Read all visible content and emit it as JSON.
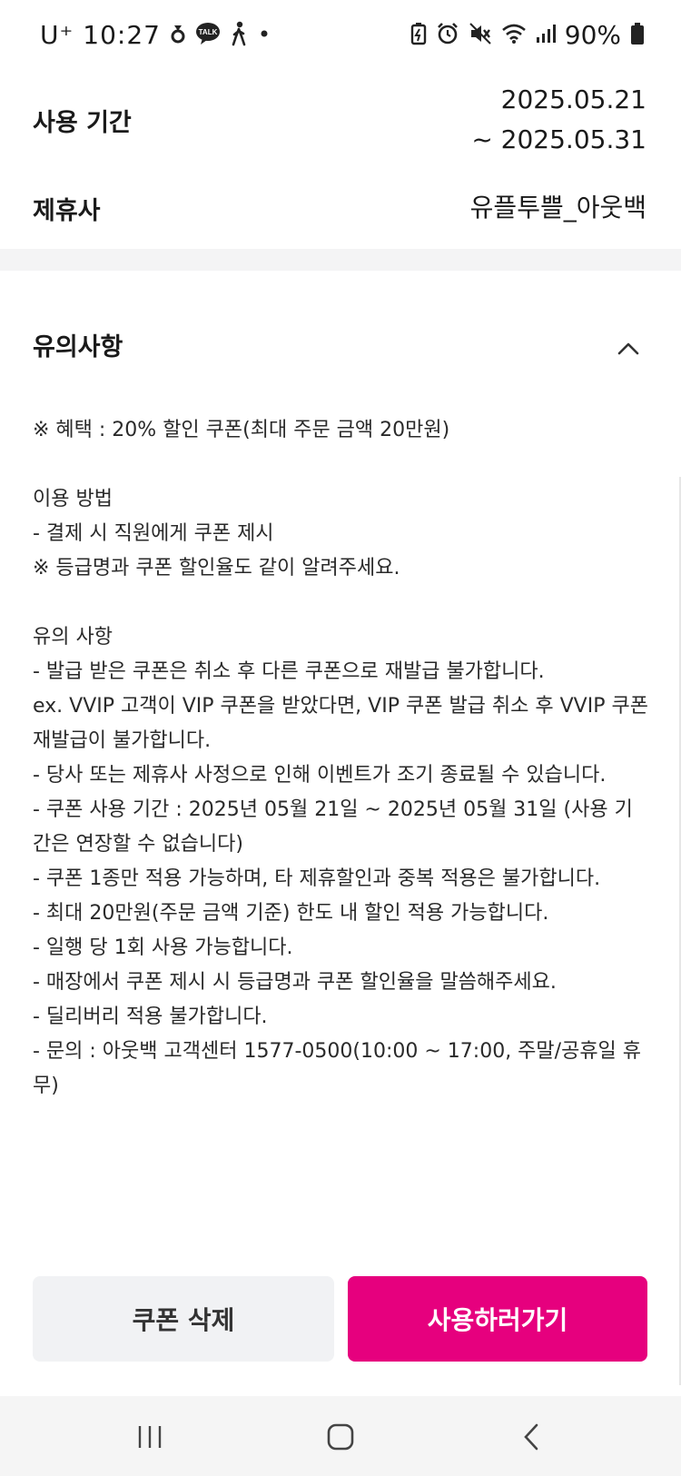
{
  "status_bar": {
    "carrier": "U⁺",
    "time": "10:27",
    "battery": "90%",
    "left_icons": [
      "notification-dot-icon",
      "kakaotalk-icon",
      "walking-icon",
      "dot-icon"
    ],
    "right_icons": [
      "battery-saver-icon",
      "alarm-icon",
      "mute-icon",
      "wifi-icon",
      "signal-icon",
      "battery-icon"
    ],
    "kakao_badge": "TALK"
  },
  "coupon_info": {
    "period_label": "사용 기간",
    "period_start": "2025.05.21",
    "period_end": "~ 2025.05.31",
    "partner_label": "제휴사",
    "partner_value": "유플투쁠_아웃백"
  },
  "notice": {
    "title": "유의사항",
    "lines": [
      "※ 혜택 : 20% 할인 쿠폰(최대 주문 금액 20만원)",
      "",
      "이용 방법",
      "- 결제 시 직원에게 쿠폰 제시",
      "※ 등급명과 쿠폰 할인율도 같이 알려주세요.",
      "",
      "유의 사항",
      "- 발급 받은 쿠폰은 취소 후 다른 쿠폰으로 재발급 불가합니다.",
      "ex. VVIP 고객이 VIP 쿠폰을 받았다면, VIP 쿠폰 발급 취소 후 VVIP 쿠폰 재발급이 불가합니다.",
      "- 당사 또는 제휴사 사정으로 인해 이벤트가 조기 종료될 수 있습니다.",
      "- 쿠폰 사용 기간 : 2025년 05월 21일 ~ 2025년 05월 31일 (사용 기간은 연장할 수 없습니다)",
      "- 쿠폰 1종만 적용 가능하며, 타 제휴할인과 중복 적용은 불가합니다.",
      "- 최대 20만원(주문 금액 기준) 한도 내 할인 적용 가능합니다.",
      "- 일행 당 1회 사용 가능합니다.",
      "- 매장에서 쿠폰 제시 시 등급명과 쿠폰 할인율을 말씀해주세요.",
      "- 딜리버리 적용 불가합니다.",
      "- 문의 : 아웃백 고객센터 1577-0500(10:00 ~ 17:00, 주말/공휴일 휴무)"
    ]
  },
  "actions": {
    "delete_label": "쿠폰 삭제",
    "use_label": "사용하러가기"
  },
  "nav_bar": {
    "icons": [
      "recents-icon",
      "home-icon",
      "back-icon"
    ]
  },
  "colors": {
    "accent": "#e6007e",
    "secondary_button": "#f1f2f4",
    "divider": "#f4f4f5"
  }
}
